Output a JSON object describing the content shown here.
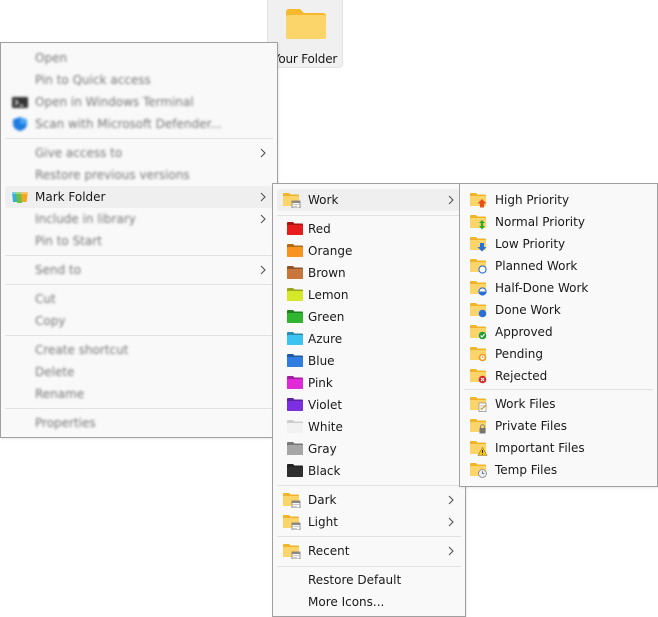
{
  "desktop": {
    "folder_label": "Your Folder",
    "folder_icon": "folder-icon"
  },
  "context_menu": {
    "items": [
      {
        "label": "Open",
        "icon": null,
        "submenu": false
      },
      {
        "label": "Pin to Quick access",
        "icon": null,
        "submenu": false
      },
      {
        "label": "Open in Windows Terminal",
        "icon": "terminal-icon",
        "submenu": false
      },
      {
        "label": "Scan with Microsoft Defender...",
        "icon": "defender-shield-icon",
        "submenu": false
      },
      {
        "label": "Give access to",
        "icon": null,
        "submenu": true
      },
      {
        "label": "Restore previous versions",
        "icon": null,
        "submenu": false
      },
      {
        "label": "Mark Folder",
        "icon": "mark-folder-icon",
        "submenu": true,
        "highlighted": true
      },
      {
        "label": "Include in library",
        "icon": null,
        "submenu": true
      },
      {
        "label": "Pin to Start",
        "icon": null,
        "submenu": false
      },
      {
        "label": "Send to",
        "icon": null,
        "submenu": true
      },
      {
        "label": "Cut",
        "icon": null,
        "submenu": false
      },
      {
        "label": "Copy",
        "icon": null,
        "submenu": false
      },
      {
        "label": "Create shortcut",
        "icon": null,
        "submenu": false
      },
      {
        "label": "Delete",
        "icon": null,
        "submenu": false
      },
      {
        "label": "Rename",
        "icon": null,
        "submenu": false
      },
      {
        "label": "Properties",
        "icon": null,
        "submenu": false
      }
    ]
  },
  "mark_folder_menu": {
    "work": {
      "label": "Work",
      "icon": "work-folder-icon",
      "submenu": true,
      "highlighted": true
    },
    "colors": [
      {
        "label": "Red",
        "color": "#e81c1c"
      },
      {
        "label": "Orange",
        "color": "#f7931e"
      },
      {
        "label": "Brown",
        "color": "#c8763a"
      },
      {
        "label": "Lemon",
        "color": "#d6e82a"
      },
      {
        "label": "Green",
        "color": "#2fb52f"
      },
      {
        "label": "Azure",
        "color": "#3cc3f2"
      },
      {
        "label": "Blue",
        "color": "#2f7de1"
      },
      {
        "label": "Pink",
        "color": "#e02ad8"
      },
      {
        "label": "Violet",
        "color": "#7b2fe0"
      },
      {
        "label": "White",
        "color": "#f2f2f2"
      },
      {
        "label": "Gray",
        "color": "#a6a6a6"
      },
      {
        "label": "Black",
        "color": "#2e2e2e"
      }
    ],
    "themes": [
      {
        "label": "Dark",
        "submenu": true
      },
      {
        "label": "Light",
        "submenu": true
      }
    ],
    "recent": {
      "label": "Recent",
      "submenu": true
    },
    "restore_default": "Restore Default",
    "more_icons": "More Icons..."
  },
  "work_menu": {
    "status_items": [
      {
        "label": "High Priority",
        "icon": "high-priority-icon"
      },
      {
        "label": "Normal Priority",
        "icon": "normal-priority-icon"
      },
      {
        "label": "Low Priority",
        "icon": "low-priority-icon"
      },
      {
        "label": "Planned Work",
        "icon": "planned-work-icon"
      },
      {
        "label": "Half-Done Work",
        "icon": "half-done-work-icon"
      },
      {
        "label": "Done Work",
        "icon": "done-work-icon"
      },
      {
        "label": "Approved",
        "icon": "approved-icon"
      },
      {
        "label": "Pending",
        "icon": "pending-icon"
      },
      {
        "label": "Rejected",
        "icon": "rejected-icon"
      }
    ],
    "file_items": [
      {
        "label": "Work Files",
        "icon": "work-files-icon"
      },
      {
        "label": "Private Files",
        "icon": "private-files-icon"
      },
      {
        "label": "Important Files",
        "icon": "important-files-icon"
      },
      {
        "label": "Temp Files",
        "icon": "temp-files-icon"
      }
    ]
  }
}
